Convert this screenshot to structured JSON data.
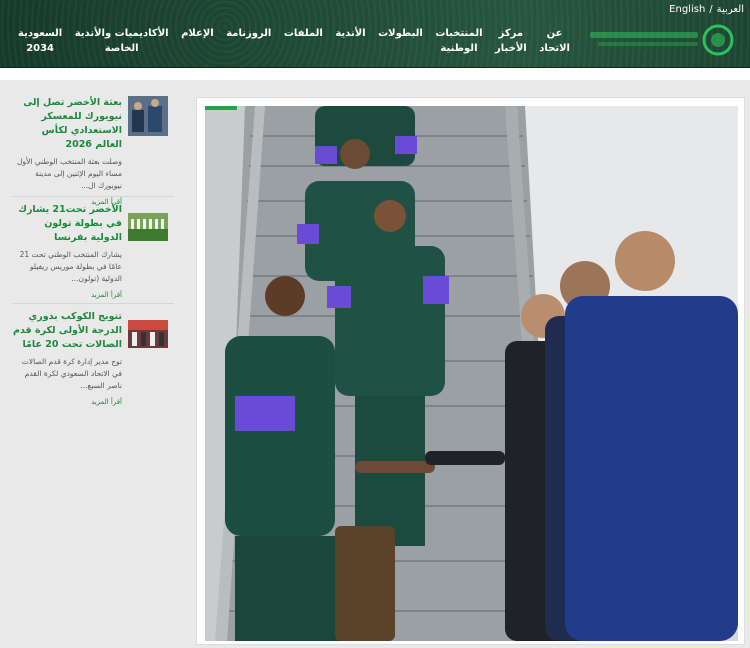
{
  "header": {
    "lang_ar": "العربية",
    "lang_sep": "/",
    "lang_en": "English",
    "nav": [
      {
        "label": "عن\nالاتحاد"
      },
      {
        "label": "مركز\nالأخبار"
      },
      {
        "label": "المنتخبات\nالوطنية"
      },
      {
        "label": "البطولات"
      },
      {
        "label": "الأندية"
      },
      {
        "label": "الملفات"
      },
      {
        "label": "الروزنامة"
      },
      {
        "label": "الإعلام"
      },
      {
        "label": "الأكاديميات والأندية\nالخاصة"
      },
      {
        "label": "السعودية\n2034"
      }
    ]
  },
  "sidebar": {
    "items": [
      {
        "title": "بعثة الأخضر تصل إلى نيويورك للمعسكر الاستعدادي لكأس العالم 2026",
        "desc": "وصلت بعثة المنتخب الوطني الأول مساء اليوم الإثنين إلى مدينة نيويورك ال...",
        "more": "أقرأ المزيد"
      },
      {
        "title": "الأخضر تحت21 يشارك في بطولة تولون الدولية بفرنسا",
        "desc": "يشارك المنتخب الوطني تحت 21 عامًا في بطولة موريس ريفيلو الدولية (تولون...",
        "more": "أقرأ المزيد"
      },
      {
        "title": "تتويج الكوكب بدوري الدرجة الأولى لكرة قدم الصالات تحت 20 عامًا",
        "desc": "توج مدير إدارة كرة قدم الصالات في الاتحاد السعودي لكرة القدم ناصر السبع...",
        "more": "أقرأ المزيد"
      }
    ]
  },
  "colors": {
    "header_bg": "#1f4a35",
    "accent_green": "#1a8a3a",
    "bar_green": "#22a34a"
  }
}
